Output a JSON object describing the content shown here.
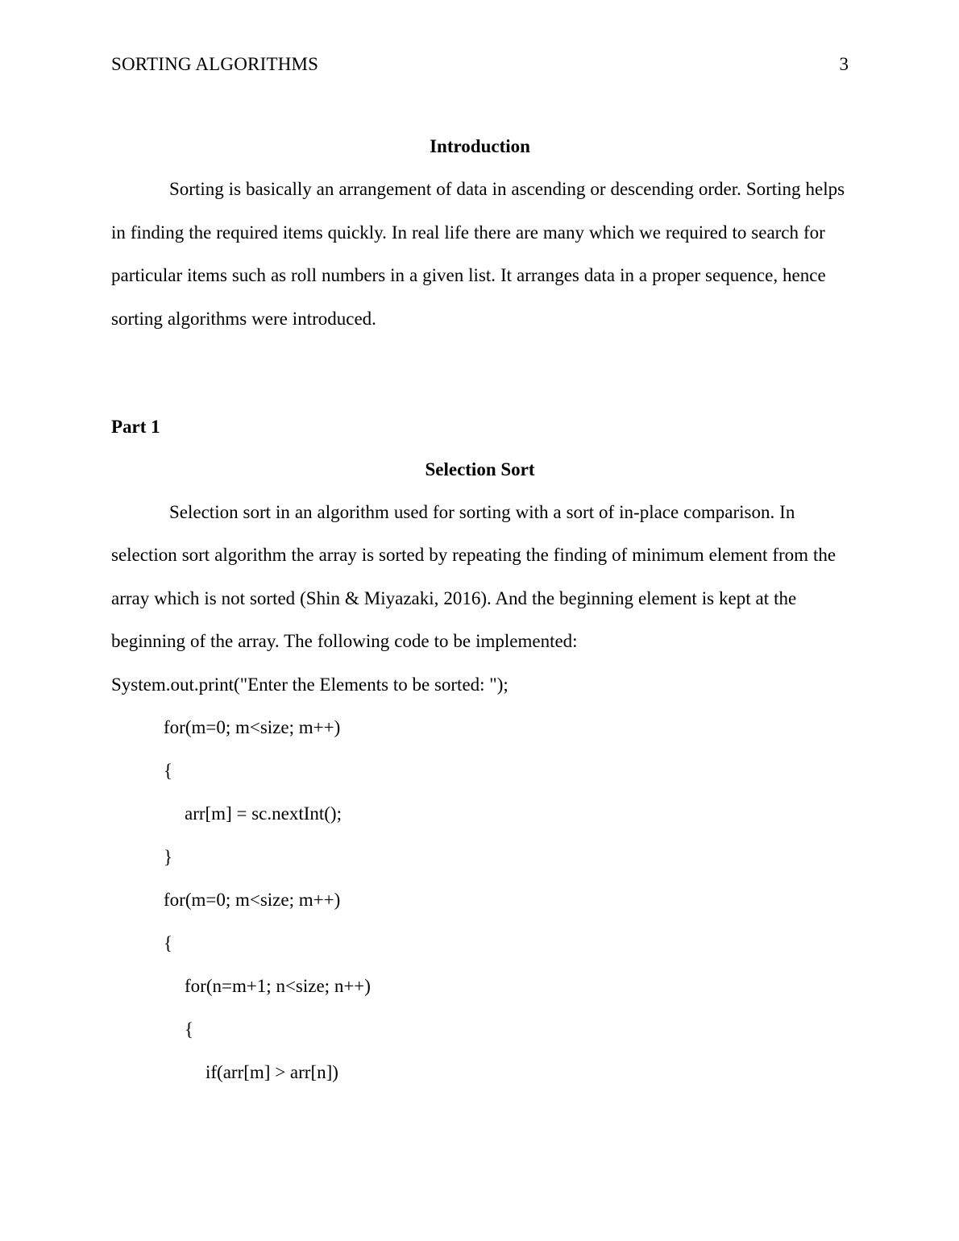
{
  "document": {
    "running_header": {
      "title": "SORTING ALGORITHMS",
      "page_number": "3"
    },
    "sections": {
      "introduction": {
        "heading": "Introduction",
        "paragraph": "Sorting is basically an arrangement of data in ascending or descending order. Sorting helps in finding the required items quickly. In real life there are many which we required to search for particular items such as roll numbers in a given list. It arranges data in a proper sequence, hence sorting algorithms were introduced."
      },
      "part_one": {
        "heading": "Part 1",
        "subheading": "Selection Sort",
        "paragraph": "Selection sort in an algorithm used for sorting with a sort of in-place comparison. In selection sort algorithm the array is sorted by repeating the finding of minimum element from the array which is not sorted (Shin & Miyazaki, 2016). And the beginning element is kept at the beginning of the array. The following code to be implemented:"
      }
    },
    "code_listing": [
      {
        "indent": 0,
        "text": "System.out.print(\"Enter the Elements to be sorted: \");"
      },
      {
        "indent": 1,
        "text": "for(m=0; m<size; m++)"
      },
      {
        "indent": 1,
        "text": "{"
      },
      {
        "indent": 2,
        "text": "arr[m] = sc.nextInt();"
      },
      {
        "indent": 1,
        "text": "}"
      },
      {
        "indent": 1,
        "text": "for(m=0; m<size; m++)"
      },
      {
        "indent": 1,
        "text": "{"
      },
      {
        "indent": 2,
        "text": "for(n=m+1; n<size; n++)"
      },
      {
        "indent": 2,
        "text": "{"
      },
      {
        "indent": 3,
        "text": "if(arr[m] > arr[n])"
      }
    ],
    "colors": {
      "page_background": "#ffffff",
      "text": "#000000"
    }
  }
}
